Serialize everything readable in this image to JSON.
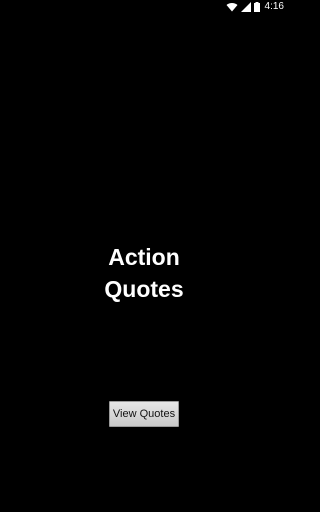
{
  "status_bar": {
    "time": "4:16",
    "icons": [
      "wifi-icon",
      "signal-icon",
      "battery-icon"
    ]
  },
  "main": {
    "title_line1": "Action",
    "title_line2": "Quotes",
    "button_label": "View Quotes"
  },
  "colors": {
    "background": "#000000",
    "text": "#ffffff",
    "button": "#d4d4d4"
  }
}
